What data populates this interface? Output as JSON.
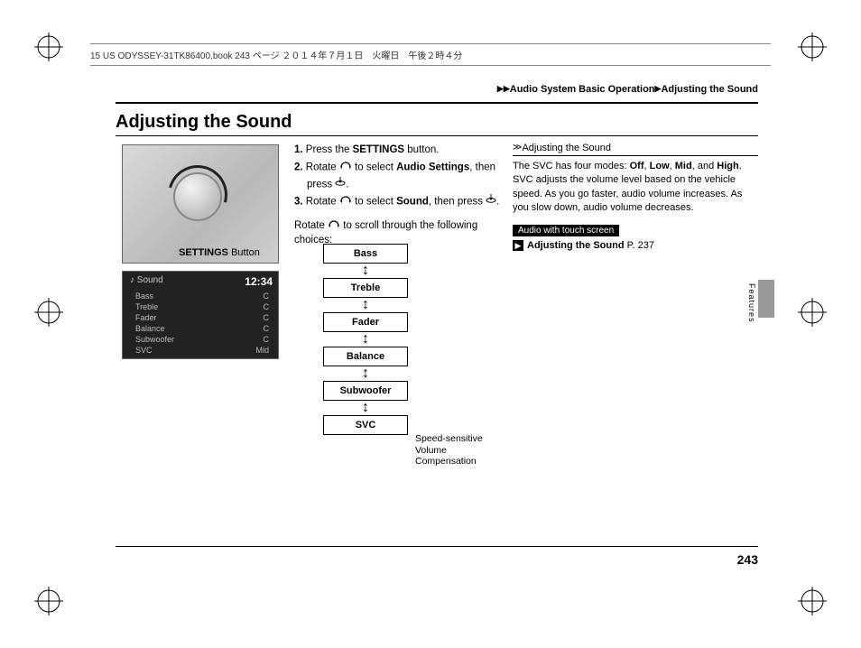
{
  "header_note": "15 US ODYSSEY-31TK86400.book  243 ページ  ２０１４年７月１日　火曜日　午後２時４分",
  "breadcrumb": {
    "a": "Audio System Basic Operation",
    "b": "Adjusting the Sound"
  },
  "title": "Adjusting the Sound",
  "caption_settings_button": "SETTINGS",
  "caption_settings_button_suffix": " Button",
  "steps": {
    "s1_a": "1.",
    "s1_b": "Press the ",
    "s1_c": "SETTINGS",
    "s1_d": " button.",
    "s2_a": "2.",
    "s2_b": "Rotate ",
    "s2_c": " to select ",
    "s2_d": "Audio Settings",
    "s2_e": ", then",
    "s2_f": "press ",
    "s2_g": ".",
    "s3_a": "3.",
    "s3_b": "Rotate ",
    "s3_c": " to select ",
    "s3_d": "Sound",
    "s3_e": ", then press ",
    "s3_f": "."
  },
  "scroll_text_a": "Rotate ",
  "scroll_text_b": " to scroll through the following choices:",
  "flow": [
    "Bass",
    "Treble",
    "Fader",
    "Balance",
    "Subwoofer",
    "SVC"
  ],
  "svc_caption": "Speed-sensitive Volume Compensation",
  "screen": {
    "title_icon": "♪",
    "title": "Sound",
    "clock": "12:34",
    "rows": [
      {
        "l": "Bass",
        "r": "C"
      },
      {
        "l": "Treble",
        "r": "C"
      },
      {
        "l": "Fader",
        "r": "C"
      },
      {
        "l": "Balance",
        "r": "C"
      },
      {
        "l": "Subwoofer",
        "r": "C"
      },
      {
        "l": "SVC",
        "r": "Mid"
      }
    ]
  },
  "side": {
    "heading": "Adjusting the Sound",
    "p1_a": "The SVC has four modes: ",
    "p1_b": "Off",
    "p1_c": ", ",
    "p1_d": "Low",
    "p1_e": ", ",
    "p1_f": "Mid",
    "p1_g": ", and ",
    "p1_h": "High",
    "p1_i": ". SVC adjusts the volume level based on the vehicle speed. As you go faster, audio volume increases. As you slow down, audio volume decreases.",
    "pill": "Audio with touch screen",
    "xref_a": "Adjusting the Sound",
    "xref_b": " P. 237"
  },
  "tab": "Features",
  "page": "243"
}
